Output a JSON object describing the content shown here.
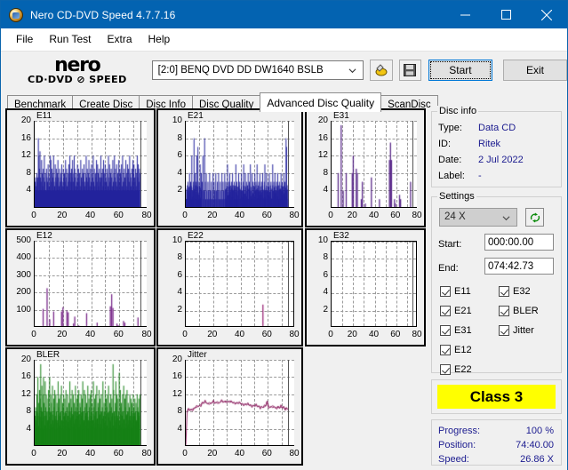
{
  "window": {
    "title": "Nero CD-DVD Speed 4.7.7.16",
    "icon": "nero-app-icon",
    "minimize": "minimize-icon",
    "maximize": "maximize-icon",
    "close": "close-icon"
  },
  "menu": {
    "items": [
      "File",
      "Run Test",
      "Extra",
      "Help"
    ]
  },
  "toolbar": {
    "logo_main": "nero",
    "logo_sub": "CD·DVD ⊘ SPEED",
    "drive": "[2:0]   BENQ DVD DD DW1640 BSLB",
    "scan_icon": "disc-scan-icon",
    "save_icon": "floppy-save-icon",
    "start_label": "Start",
    "exit_label": "Exit"
  },
  "tabs": {
    "items": [
      "Benchmark",
      "Create Disc",
      "Disc Info",
      "Disc Quality",
      "Advanced Disc Quality",
      "ScanDisc"
    ],
    "active": "Advanced Disc Quality"
  },
  "disc_info": {
    "title": "Disc info",
    "rows": [
      {
        "key": "Type:",
        "value": "Data CD"
      },
      {
        "key": "ID:",
        "value": "Ritek"
      },
      {
        "key": "Date:",
        "value": "2 Jul 2022"
      },
      {
        "key": "Label:",
        "value": "-"
      }
    ]
  },
  "settings": {
    "title": "Settings",
    "speed": "24 X",
    "refresh_icon": "refresh-arrows-icon",
    "start_label": "Start:",
    "start_value": "000:00.00",
    "end_label": "End:",
    "end_value": "074:42.73"
  },
  "checkboxes": {
    "left": [
      {
        "label": "E11",
        "checked": true
      },
      {
        "label": "E21",
        "checked": true
      },
      {
        "label": "E31",
        "checked": true
      },
      {
        "label": "E12",
        "checked": true
      },
      {
        "label": "E22",
        "checked": true
      }
    ],
    "right": [
      {
        "label": "E32",
        "checked": true
      },
      {
        "label": "BLER",
        "checked": true
      },
      {
        "label": "Jitter",
        "checked": true
      }
    ]
  },
  "class_badge": {
    "text": "Class 3",
    "color": "#ffff00"
  },
  "status": {
    "rows": [
      {
        "key": "Progress:",
        "value": "100 %"
      },
      {
        "key": "Position:",
        "value": "74:40.00"
      },
      {
        "key": "Speed:",
        "value": "26.86 X"
      }
    ]
  },
  "chart_data": [
    {
      "id": "E11",
      "type": "bar",
      "title": "E11",
      "color": "#22229c",
      "xlabel": "",
      "ylabel": "",
      "xlim": [
        0,
        80
      ],
      "ylim": [
        0,
        20
      ],
      "xticks": [
        0,
        20,
        40,
        60,
        80
      ],
      "yticks": [
        4,
        8,
        12,
        16,
        20
      ],
      "grid": true,
      "data_end": 74.7,
      "note": "dense filled bars spanning 0-74.7 min, baseline ~3-7, peaks to 16",
      "values": [
        6,
        7,
        5,
        8,
        6,
        7,
        16,
        12,
        9,
        13,
        7,
        6,
        11,
        8,
        5,
        9,
        7,
        12,
        6,
        8,
        4,
        9,
        7,
        6,
        10,
        8,
        5,
        7,
        12,
        11,
        6,
        9,
        8,
        7,
        12,
        6,
        5,
        10,
        7,
        9,
        6,
        8,
        11,
        7,
        5,
        9,
        6,
        8,
        7,
        10,
        6,
        5,
        9,
        7,
        8,
        6,
        11,
        7,
        9,
        5,
        8,
        6,
        10,
        7,
        12,
        8,
        6,
        9,
        7,
        11,
        6,
        8,
        12,
        9,
        7,
        5,
        8,
        6,
        10,
        7,
        9,
        6,
        8,
        5,
        11,
        7,
        6,
        9,
        8,
        7,
        10,
        6,
        5,
        8,
        12,
        7,
        9,
        6,
        8,
        11,
        7,
        5,
        9,
        6,
        10,
        8,
        7,
        12,
        6,
        9,
        5,
        8,
        7,
        11,
        6,
        10,
        8,
        5,
        9,
        7,
        6,
        12,
        8,
        7,
        9,
        5,
        11,
        6,
        8,
        10,
        7,
        6,
        9,
        8,
        5,
        12,
        7,
        10,
        6,
        8,
        9,
        7,
        5,
        11,
        6,
        8,
        12,
        7,
        9,
        6,
        10,
        5,
        8,
        7,
        11,
        6,
        9,
        8,
        7,
        10,
        5,
        12,
        6,
        8,
        9,
        7,
        6,
        11,
        8,
        5,
        10,
        7,
        9,
        6,
        12,
        8,
        7,
        5,
        9,
        6,
        11,
        8,
        10,
        7,
        6,
        9,
        5,
        8,
        12,
        7,
        10,
        6,
        9,
        8
      ]
    },
    {
      "id": "E21",
      "type": "bar",
      "title": "E21",
      "color": "#22229c",
      "xlim": [
        0,
        80
      ],
      "ylim": [
        0,
        10
      ],
      "xticks": [
        0,
        20,
        40,
        60,
        80
      ],
      "yticks": [
        2,
        4,
        6,
        8,
        10
      ],
      "grid": true,
      "data_end": 74.7,
      "note": "sparse to moderate bars, peaks 6-8, final spike to 8 near 74",
      "values": [
        1,
        2,
        1,
        3,
        2,
        1,
        4,
        2,
        3,
        1,
        6,
        2,
        1,
        3,
        8,
        2,
        4,
        1,
        3,
        6,
        2,
        7,
        1,
        3,
        2,
        5,
        1,
        4,
        2,
        3,
        6,
        1,
        2,
        8,
        3,
        1,
        4,
        2,
        1,
        3,
        2,
        1,
        4,
        2,
        1,
        3,
        1,
        2,
        4,
        1,
        3,
        2,
        1,
        4,
        2,
        1,
        3,
        2,
        4,
        1,
        2,
        3,
        1,
        2,
        4,
        1,
        3,
        2,
        1,
        4,
        2,
        3,
        1,
        2,
        5,
        1,
        3,
        2,
        4,
        1,
        2,
        3,
        1,
        4,
        2,
        1,
        3,
        2,
        1,
        5,
        2,
        3,
        1,
        2,
        4,
        1,
        3,
        2,
        1,
        4,
        2,
        1,
        3,
        5,
        2,
        1,
        4,
        2,
        3,
        1,
        2,
        4,
        1,
        3,
        2,
        5,
        1,
        2,
        4,
        1,
        3,
        2,
        1,
        4,
        2,
        3,
        1,
        5,
        2,
        1,
        3,
        2,
        4,
        1,
        2,
        3,
        1,
        4,
        2,
        1,
        3,
        5,
        2,
        1,
        4,
        2,
        1,
        3,
        2,
        4,
        1,
        2,
        3,
        1,
        2,
        5,
        1,
        3,
        2,
        4,
        1,
        2,
        3,
        1,
        4,
        2,
        1,
        3,
        2,
        1,
        4,
        2,
        3,
        1,
        2,
        4,
        1,
        3,
        2,
        8,
        7,
        2,
        1
      ]
    },
    {
      "id": "E31",
      "type": "bar",
      "title": "E31",
      "color": "#5a2a8a",
      "xlim": [
        0,
        80
      ],
      "ylim": [
        0,
        20
      ],
      "xticks": [
        0,
        20,
        40,
        60,
        80
      ],
      "yticks": [
        4,
        8,
        12,
        16,
        20
      ],
      "grid": true,
      "data_end": 74.7,
      "note": "very sparse spikes; tallest ~19 near x=9, ~12 near x=21, ~15 near x=59",
      "values": [
        0,
        0,
        0,
        0,
        0,
        0,
        8,
        0,
        0,
        19,
        0,
        4,
        0,
        0,
        8,
        0,
        0,
        0,
        0,
        0,
        8,
        12,
        0,
        0,
        9,
        8,
        0,
        0,
        0,
        2,
        6,
        0,
        0,
        1,
        0,
        0,
        0,
        0,
        0,
        7,
        0,
        0,
        0,
        0,
        0,
        0,
        0,
        2,
        0,
        0,
        0,
        0,
        0,
        0,
        0,
        0,
        0,
        11,
        15,
        11,
        0,
        0,
        2,
        1,
        0,
        0,
        0,
        3,
        2,
        0,
        0,
        0,
        0,
        0,
        0,
        0,
        0,
        0,
        6,
        0
      ]
    },
    {
      "id": "E12",
      "type": "bar",
      "title": "E12",
      "color": "#7a2a8a",
      "xlim": [
        0,
        80
      ],
      "ylim": [
        0,
        500
      ],
      "xticks": [
        0,
        20,
        40,
        60,
        80
      ],
      "yticks": [
        100,
        200,
        300,
        400,
        500
      ],
      "grid": true,
      "data_end": 74.7,
      "note": "sparse spikes; tallest ~225 near x=9, ~190 near x=59, ~100 baseline hits",
      "values": [
        0,
        0,
        0,
        0,
        0,
        0,
        105,
        0,
        0,
        225,
        0,
        45,
        0,
        0,
        90,
        0,
        0,
        0,
        0,
        0,
        90,
        115,
        0,
        0,
        95,
        85,
        0,
        0,
        0,
        20,
        60,
        0,
        0,
        10,
        0,
        0,
        0,
        0,
        0,
        80,
        0,
        0,
        0,
        0,
        0,
        0,
        0,
        25,
        0,
        0,
        0,
        0,
        0,
        0,
        0,
        0,
        0,
        120,
        190,
        110,
        0,
        0,
        20,
        10,
        0,
        0,
        0,
        35,
        25,
        0,
        0,
        0,
        0,
        0,
        0,
        0,
        0,
        0,
        55,
        0
      ]
    },
    {
      "id": "E22",
      "type": "bar",
      "title": "E22",
      "color": "#9c2a7a",
      "xlim": [
        0,
        80
      ],
      "ylim": [
        0,
        10
      ],
      "xticks": [
        0,
        20,
        40,
        60,
        80
      ],
      "yticks": [
        2,
        4,
        6,
        8,
        10
      ],
      "grid": true,
      "data_end": 74.7,
      "note": "empty except a single bar of height ~2.7 at x=60",
      "values": [
        0,
        0,
        0,
        0,
        0,
        0,
        0,
        0,
        0,
        0,
        0,
        0,
        0,
        0,
        0,
        0,
        0,
        0,
        0,
        0,
        0,
        0,
        0,
        0,
        0,
        0,
        0,
        0,
        0,
        0,
        0,
        0,
        0,
        0,
        0,
        0,
        0,
        0,
        0,
        0,
        0,
        0,
        0,
        0,
        0,
        0,
        0,
        0,
        0,
        0,
        0,
        0,
        0,
        0,
        0,
        0,
        0,
        0,
        0,
        0,
        2.7,
        0,
        0,
        0,
        0,
        0,
        0,
        0,
        0,
        0,
        0,
        0,
        0,
        0,
        0,
        0,
        0,
        0,
        0,
        0
      ]
    },
    {
      "id": "E32",
      "type": "bar",
      "title": "E32",
      "color": "#9c2a7a",
      "xlim": [
        0,
        80
      ],
      "ylim": [
        0,
        10
      ],
      "xticks": [
        0,
        20,
        40,
        60,
        80
      ],
      "yticks": [
        2,
        4,
        6,
        8,
        10
      ],
      "grid": true,
      "data_end": 74.7,
      "note": "no data points at all",
      "values": []
    },
    {
      "id": "BLER",
      "type": "bar",
      "title": "BLER",
      "color": "#168016",
      "xlim": [
        0,
        80
      ],
      "ylim": [
        0,
        20
      ],
      "xticks": [
        0,
        20,
        40,
        60,
        80
      ],
      "yticks": [
        4,
        8,
        12,
        16,
        20
      ],
      "grid": true,
      "data_end": 74.7,
      "note": "dense green bars, baseline ~5-9, frequent peaks 12-19",
      "values": [
        7,
        9,
        6,
        12,
        8,
        16,
        10,
        7,
        13,
        11,
        19,
        9,
        14,
        8,
        12,
        16,
        10,
        7,
        15,
        9,
        12,
        8,
        6,
        11,
        13,
        9,
        16,
        7,
        12,
        10,
        8,
        14,
        6,
        11,
        9,
        13,
        7,
        12,
        8,
        10,
        6,
        15,
        9,
        11,
        7,
        12,
        8,
        14,
        6,
        10,
        9,
        12,
        7,
        11,
        8,
        13,
        6,
        9,
        12,
        7,
        10,
        8,
        15,
        6,
        11,
        9,
        13,
        7,
        12,
        8,
        10,
        6,
        14,
        9,
        11,
        7,
        12,
        8,
        13,
        6,
        10,
        9,
        12,
        7,
        11,
        15,
        8,
        6,
        13,
        9,
        12,
        7,
        10,
        8,
        14,
        6,
        11,
        9,
        12,
        7,
        13,
        8,
        10,
        6,
        15,
        9,
        11,
        7,
        12,
        8,
        14,
        6,
        10,
        9,
        13,
        7,
        11,
        8,
        12,
        6,
        9,
        15,
        7,
        10,
        8,
        13,
        6,
        11,
        9,
        12,
        7,
        14,
        8,
        10,
        6,
        12,
        9,
        11,
        7,
        19,
        13,
        8,
        6,
        10,
        15,
        9,
        12,
        7,
        11,
        8,
        17,
        6,
        13,
        9,
        10,
        7,
        12,
        8,
        14,
        6,
        11,
        9,
        12,
        7,
        13,
        8,
        10,
        6,
        9,
        12,
        7,
        11,
        8,
        10,
        6,
        12,
        9,
        7,
        11,
        8,
        10,
        6,
        12,
        9,
        8,
        11,
        7,
        12
      ]
    },
    {
      "id": "Jitter",
      "type": "line",
      "title": "Jitter",
      "color": "#8c2060",
      "xlim": [
        0,
        80
      ],
      "ylim": [
        0,
        20
      ],
      "xticks": [
        0,
        20,
        40,
        60,
        80
      ],
      "yticks": [
        4,
        8,
        12,
        16,
        20
      ],
      "grid": true,
      "data_end": 74.7,
      "note": "noisy line rising 8.2 -> ~10.5 around x=30 then drifting back to ~8.6",
      "values": [
        0,
        8.2,
        8.3,
        8.4,
        8.5,
        8.6,
        8.7,
        8.9,
        9.0,
        9.2,
        9.4,
        9.6,
        10.1,
        9.9,
        10.2,
        10.0,
        9.8,
        10.1,
        9.9,
        10.0,
        10.2,
        9.9,
        10.1,
        10.3,
        10.0,
        10.2,
        10.4,
        10.1,
        10.3,
        10.5,
        10.2,
        10.4,
        10.1,
        10.3,
        10.0,
        10.2,
        9.9,
        10.1,
        9.8,
        10.0,
        9.7,
        9.9,
        9.6,
        9.8,
        9.5,
        9.7,
        9.4,
        9.6,
        9.3,
        9.5,
        9.2,
        9.4,
        9.1,
        9.3,
        9.0,
        9.2,
        8.9,
        9.1,
        9.3,
        10.4,
        9.2,
        9.0,
        9.2,
        8.9,
        9.1,
        8.8,
        9.0,
        9.2,
        8.9,
        9.1,
        8.8,
        9.0,
        8.7,
        8.9,
        8.6
      ]
    }
  ]
}
